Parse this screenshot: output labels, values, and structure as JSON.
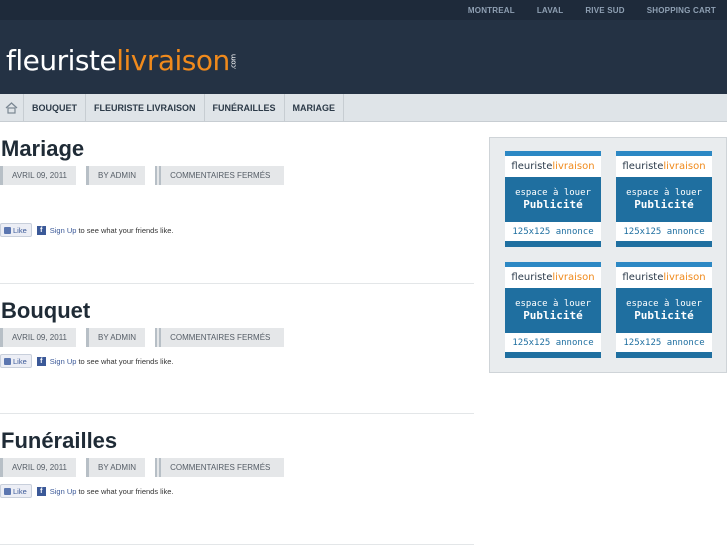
{
  "topnav": [
    "MONTREAL",
    "LAVAL",
    "RIVE SUD",
    "SHOPPING CART"
  ],
  "logo": {
    "part1": "fleuriste",
    "part2": "livraison",
    "part3": ".com"
  },
  "mainnav": [
    "BOUQUET",
    "FLEURISTE LIVRAISON",
    "FUNÉRAILLES",
    "MARIAGE"
  ],
  "posts": [
    {
      "title": "Mariage",
      "date": "AVRIL 09, 2011",
      "author": "BY ADMIN",
      "comments": "COMMENTAIRES FERMÉS"
    },
    {
      "title": "Bouquet",
      "date": "AVRIL 09, 2011",
      "author": "BY ADMIN",
      "comments": "COMMENTAIRES FERMÉS"
    },
    {
      "title": "Funérailles",
      "date": "AVRIL 09, 2011",
      "author": "BY ADMIN",
      "comments": "COMMENTAIRES FERMÉS"
    }
  ],
  "facebook": {
    "like": "Like",
    "signup": "Sign Up",
    "text": "to see what your friends like."
  },
  "ad": {
    "brand1": "fleuriste",
    "brand2": "livraison",
    "line1": "espace à louer",
    "line2": "Publicité",
    "line3": "125x125 annonce"
  },
  "colors": {
    "header_bg": "#243244",
    "accent": "#f08a1c",
    "ad_blue": "#1f6fa0"
  }
}
